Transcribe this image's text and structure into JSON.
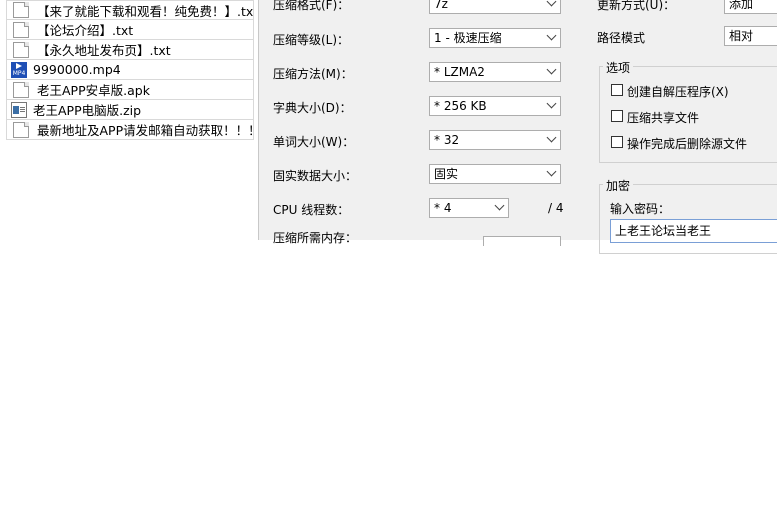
{
  "files": [
    {
      "name": "【来了就能下载和观看！纯免费！】.txt",
      "icon": "txt-file-icon"
    },
    {
      "name": "【论坛介绍】.txt",
      "icon": "txt-file-icon"
    },
    {
      "name": "【永久地址发布页】.txt",
      "icon": "txt-file-icon"
    },
    {
      "name": "9990000.mp4",
      "icon": "mp4-file-icon",
      "badge": "MP4"
    },
    {
      "name": "老王APP安卓版.apk",
      "icon": "apk-file-icon"
    },
    {
      "name": "老王APP电脑版.zip",
      "icon": "zip-file-icon"
    },
    {
      "name": "最新地址及APP请发邮箱自动获取！！！...",
      "icon": "txt-file-icon"
    }
  ],
  "dialog": {
    "format_label": "压缩格式(F)：",
    "format_value": "7z",
    "level_label": "压缩等级(L)：",
    "level_value": "1 - 极速压缩",
    "method_label": "压缩方法(M)：",
    "method_value": "* LZMA2",
    "dict_label": "字典大小(D)：",
    "dict_value": "* 256 KB",
    "word_label": "单词大小(W)：",
    "word_value": "* 32",
    "solid_label": "固实数据大小：",
    "solid_value": "固实",
    "cpu_label": "CPU 线程数：",
    "cpu_value": "* 4",
    "cpu_total": "/ 4",
    "memory_label": "压缩所需内存：",
    "update_label": "更新方式(U)：",
    "update_value": "添加",
    "path_label": "路径模式",
    "path_value": "相对",
    "options_title": "选项",
    "opt_sfx": "创建自解压程序(X)",
    "opt_shared": "压缩共享文件",
    "opt_delete": "操作完成后删除源文件",
    "encrypt_title": "加密",
    "password_label": "输入密码：",
    "password_value": "上老王论坛当老王"
  }
}
